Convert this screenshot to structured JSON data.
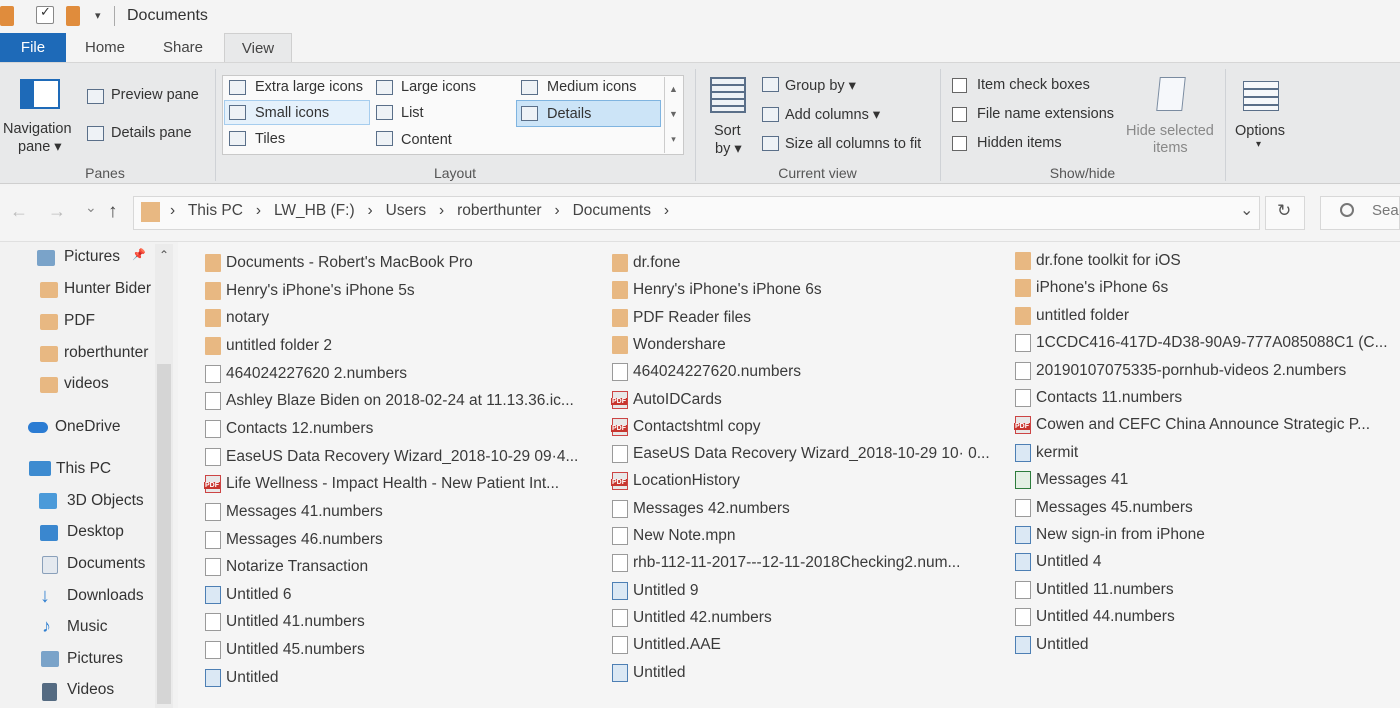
{
  "window": {
    "title": "Documents"
  },
  "tabs": {
    "file": "File",
    "home": "Home",
    "share": "Share",
    "view": "View"
  },
  "panes": {
    "navigation": "Navigation",
    "navigation2": "pane ▾",
    "preview": "Preview pane",
    "details": "Details pane",
    "group": "Panes"
  },
  "layout": {
    "extra_large": "Extra large icons",
    "large": "Large icons",
    "medium": "Medium icons",
    "small": "Small icons",
    "list": "List",
    "details": "Details",
    "tiles": "Tiles",
    "content": "Content",
    "group": "Layout"
  },
  "current_view": {
    "sort": "Sort",
    "sort2": "by ▾",
    "group_by": "Group by ▾",
    "add_columns": "Add columns ▾",
    "size_all": "Size all columns to fit",
    "group": "Current view"
  },
  "show_hide": {
    "item_check": "Item check boxes",
    "file_ext": "File name extensions",
    "hidden": "Hidden items",
    "hide_selected": "Hide selected",
    "hide_selected2": "items",
    "group": "Show/hide"
  },
  "options": {
    "label": "Options",
    "arrow": "▾"
  },
  "nav": {
    "back": "←",
    "forward": "→",
    "recent": "⌄",
    "up": "↑",
    "dropdown": "⌄",
    "refresh": "↻",
    "search_placeholder": "Sea"
  },
  "breadcrumb": [
    "This PC",
    "LW_HB (F:)",
    "Users",
    "roberthunter",
    "Documents"
  ],
  "breadcrumb_sep": "›",
  "sidebar": {
    "quick": [
      {
        "label": "Pictures",
        "pin": "📌"
      },
      {
        "label": "Hunter Bider"
      },
      {
        "label": "PDF"
      },
      {
        "label": "roberthunter"
      },
      {
        "label": "videos"
      }
    ],
    "onedrive": "OneDrive",
    "thispc": "This PC",
    "pc_items": [
      "3D Objects",
      "Desktop",
      "Documents",
      "Downloads",
      "Music",
      "Pictures",
      "Videos"
    ]
  },
  "files": {
    "col1": [
      {
        "name": "Documents - Robert's MacBook Pro",
        "type": "folder"
      },
      {
        "name": "Henry's iPhone's iPhone 5s",
        "type": "folder"
      },
      {
        "name": "notary",
        "type": "folder"
      },
      {
        "name": "untitled folder 2",
        "type": "folder"
      },
      {
        "name": "464024227620 2.numbers",
        "type": "doc"
      },
      {
        "name": "Ashley Blaze Biden on 2018-02-24 at 11.13.36.ic...",
        "type": "doc"
      },
      {
        "name": "Contacts 12.numbers",
        "type": "doc"
      },
      {
        "name": "EaseUS Data Recovery Wizard_2018-10-29 09·4...",
        "type": "doc"
      },
      {
        "name": "Life Wellness - Impact Health - New Patient Int...",
        "type": "pdf"
      },
      {
        "name": "Messages 41.numbers",
        "type": "doc"
      },
      {
        "name": "Messages 46.numbers",
        "type": "doc"
      },
      {
        "name": "Notarize Transaction",
        "type": "doc"
      },
      {
        "name": "Untitled 6",
        "type": "img"
      },
      {
        "name": "Untitled 41.numbers",
        "type": "doc"
      },
      {
        "name": "Untitled 45.numbers",
        "type": "doc"
      },
      {
        "name": "Untitled",
        "type": "img"
      }
    ],
    "col2": [
      {
        "name": "dr.fone",
        "type": "folder"
      },
      {
        "name": "Henry's iPhone's iPhone 6s",
        "type": "folder"
      },
      {
        "name": "PDF Reader files",
        "type": "folder"
      },
      {
        "name": "Wondershare",
        "type": "folder"
      },
      {
        "name": "464024227620.numbers",
        "type": "doc"
      },
      {
        "name": "AutoIDCards",
        "type": "pdf"
      },
      {
        "name": "Contactshtml copy",
        "type": "pdf"
      },
      {
        "name": "EaseUS Data Recovery Wizard_2018-10-29 10· 0...",
        "type": "doc"
      },
      {
        "name": "LocationHistory",
        "type": "pdf"
      },
      {
        "name": "Messages 42.numbers",
        "type": "doc"
      },
      {
        "name": "New Note.mpn",
        "type": "doc"
      },
      {
        "name": "rhb-112-11-2017---12-11-2018Checking2.num...",
        "type": "doc"
      },
      {
        "name": "Untitled 9",
        "type": "img"
      },
      {
        "name": "Untitled 42.numbers",
        "type": "doc"
      },
      {
        "name": "Untitled.AAE",
        "type": "doc"
      },
      {
        "name": "Untitled",
        "type": "img"
      }
    ],
    "col3": [
      {
        "name": "dr.fone toolkit for iOS",
        "type": "folder"
      },
      {
        "name": "iPhone's iPhone 6s",
        "type": "folder"
      },
      {
        "name": "untitled folder",
        "type": "folder"
      },
      {
        "name": "1CCDC416-417D-4D38-90A9-777A085088C1 (C...",
        "type": "doc"
      },
      {
        "name": "20190107075335-pornhub-videos 2.numbers",
        "type": "doc"
      },
      {
        "name": "Contacts 11.numbers",
        "type": "doc"
      },
      {
        "name": "Cowen and CEFC China Announce Strategic P...",
        "type": "pdf"
      },
      {
        "name": "kermit",
        "type": "img"
      },
      {
        "name": "Messages 41",
        "type": "xls"
      },
      {
        "name": "Messages 45.numbers",
        "type": "doc"
      },
      {
        "name": "New sign-in from iPhone",
        "type": "img"
      },
      {
        "name": "Untitled 4",
        "type": "img"
      },
      {
        "name": "Untitled 11.numbers",
        "type": "doc"
      },
      {
        "name": "Untitled 44.numbers",
        "type": "doc"
      },
      {
        "name": "Untitled",
        "type": "img"
      }
    ]
  },
  "colors": {
    "file_tab": "#1e6ab8",
    "selected": "#cce4f7",
    "selected_border": "#7fb4e0",
    "folder": "#e8b882"
  }
}
